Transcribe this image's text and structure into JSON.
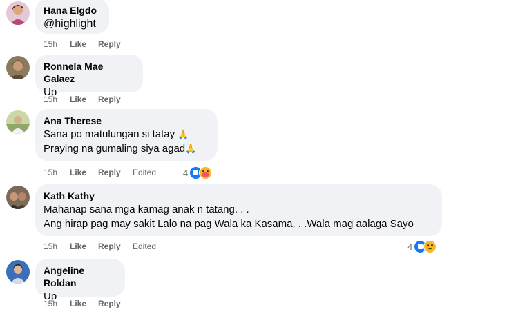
{
  "colors": {
    "bubble": "#f0f2f5",
    "meta": "#65676b",
    "like": "#1877f2"
  },
  "comments": [
    {
      "author": "Hana Elgdo",
      "lines": [
        "@highlight"
      ],
      "time": "15h",
      "like": "Like",
      "reply": "Reply"
    },
    {
      "author": "Ronnela Mae Galaez",
      "lines": [
        "Up"
      ],
      "time": "15h",
      "like": "Like",
      "reply": "Reply"
    },
    {
      "author": "Ana Therese",
      "lines": [
        "Sana po matulungan si tatay",
        "Praying na gumaling siya agad"
      ],
      "emoji": "🙏",
      "time": "15h",
      "like": "Like",
      "reply": "Reply",
      "edited": "Edited",
      "reaction_count": "4",
      "reactions": [
        "like-icon",
        "care-icon"
      ]
    },
    {
      "author": "Kath Kathy",
      "lines": [
        "Mahanap sana mga kamag anak n tatang. . .",
        "Ang hirap pag may sakit Lalo na pag Wala ka Kasama. . .Wala mag aalaga Sayo"
      ],
      "time": "15h",
      "like": "Like",
      "reply": "Reply",
      "edited": "Edited",
      "reaction_count": "4",
      "reactions": [
        "like-icon",
        "sad-icon"
      ]
    },
    {
      "author": "Angeline Roldan",
      "lines": [
        "Up"
      ],
      "time": "15h",
      "like": "Like",
      "reply": "Reply"
    }
  ]
}
